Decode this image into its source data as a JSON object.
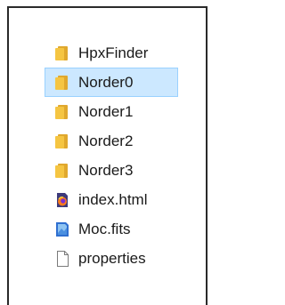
{
  "explorer": {
    "items": [
      {
        "name": "HpxFinder",
        "icon": "folder-icon",
        "selected": false
      },
      {
        "name": "Norder0",
        "icon": "folder-icon",
        "selected": true
      },
      {
        "name": "Norder1",
        "icon": "folder-icon",
        "selected": false
      },
      {
        "name": "Norder2",
        "icon": "folder-icon",
        "selected": false
      },
      {
        "name": "Norder3",
        "icon": "folder-icon",
        "selected": false
      },
      {
        "name": "index.html",
        "icon": "firefox-html-icon",
        "selected": false
      },
      {
        "name": "Moc.fits",
        "icon": "fits-file-icon",
        "selected": false
      },
      {
        "name": "properties",
        "icon": "blank-file-icon",
        "selected": false
      }
    ],
    "colors": {
      "folder": "#f5c542",
      "folder_dark": "#e0a82e",
      "selection_bg": "#cce8ff",
      "selection_border": "#99d1ff"
    }
  }
}
